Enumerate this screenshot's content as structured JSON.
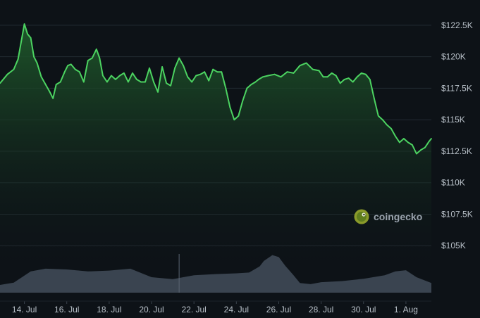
{
  "chart_data": {
    "type": "area",
    "title": "",
    "xlabel": "",
    "ylabel": "",
    "ylim": [
      102500,
      123500
    ],
    "y_ticks": [
      {
        "value": 122500,
        "label": "$122.5K"
      },
      {
        "value": 120000,
        "label": "$120K"
      },
      {
        "value": 117500,
        "label": "$117.5K"
      },
      {
        "value": 115000,
        "label": "$115K"
      },
      {
        "value": 112500,
        "label": "$112.5K"
      },
      {
        "value": 110000,
        "label": "$110K"
      },
      {
        "value": 107500,
        "label": "$107.5K"
      },
      {
        "value": 105000,
        "label": "$105K"
      }
    ],
    "x_ticks": [
      "14. Jul",
      "16. Jul",
      "18. Jul",
      "20. Jul",
      "22. Jul",
      "24. Jul",
      "26. Jul",
      "28. Jul",
      "30. Jul",
      "1. Aug"
    ],
    "x_tick_days": [
      0,
      2,
      4,
      6,
      8,
      10,
      12,
      14,
      16,
      18
    ],
    "xlim_days": [
      -1.15,
      19.2
    ],
    "series": [
      {
        "name": "",
        "x_days": [
          -1.15,
          -0.8,
          -0.5,
          -0.3,
          -0.15,
          0,
          0.15,
          0.3,
          0.45,
          0.6,
          0.8,
          1.0,
          1.2,
          1.35,
          1.5,
          1.7,
          1.9,
          2.05,
          2.2,
          2.4,
          2.6,
          2.8,
          3.0,
          3.2,
          3.4,
          3.55,
          3.7,
          3.9,
          4.1,
          4.3,
          4.5,
          4.7,
          4.9,
          5.1,
          5.3,
          5.5,
          5.7,
          5.9,
          6.1,
          6.3,
          6.5,
          6.7,
          6.9,
          7.1,
          7.3,
          7.5,
          7.7,
          7.9,
          8.1,
          8.3,
          8.5,
          8.7,
          8.9,
          9.1,
          9.3,
          9.5,
          9.7,
          9.9,
          10.1,
          10.3,
          10.5,
          10.7,
          10.9,
          11.05,
          11.25,
          11.5,
          11.8,
          12.1,
          12.4,
          12.7,
          13.0,
          13.3,
          13.6,
          13.9,
          14.1,
          14.3,
          14.5,
          14.7,
          14.9,
          15.1,
          15.3,
          15.5,
          15.7,
          15.9,
          16.1,
          16.3,
          16.5,
          16.7,
          16.9,
          17.1,
          17.3,
          17.5,
          17.7,
          17.9,
          18.1,
          18.3,
          18.5,
          18.7,
          18.9,
          19.1,
          19.2
        ],
        "values": [
          117900,
          118600,
          119000,
          119800,
          121200,
          122600,
          121800,
          121500,
          120000,
          119500,
          118400,
          117800,
          117200,
          116700,
          117800,
          118000,
          118800,
          119300,
          119400,
          119000,
          118800,
          118000,
          119700,
          119900,
          120600,
          119900,
          118500,
          118000,
          118500,
          118200,
          118500,
          118700,
          118000,
          118700,
          118200,
          118000,
          118000,
          119100,
          118000,
          117200,
          119200,
          117900,
          117700,
          119100,
          119900,
          119300,
          118400,
          118000,
          118500,
          118600,
          118800,
          118100,
          119000,
          118800,
          118800,
          117500,
          116000,
          115000,
          115300,
          116500,
          117500,
          117800,
          118000,
          118200,
          118400,
          118500,
          118600,
          118400,
          118800,
          118700,
          119300,
          119500,
          119000,
          118900,
          118400,
          118400,
          118700,
          118500,
          117900,
          118200,
          118300,
          118000,
          118400,
          118700,
          118600,
          118200,
          116700,
          115300,
          115000,
          114600,
          114300,
          113700,
          113200,
          113500,
          113200,
          113000,
          112300,
          112600,
          112800,
          113300,
          113500
        ]
      }
    ],
    "volume_x_days": [
      -1.15,
      -0.5,
      0.3,
      1.0,
      2.0,
      3.0,
      4.0,
      5.0,
      6.0,
      7.0,
      8.0,
      9.0,
      10.0,
      10.6,
      11.1,
      11.3,
      11.7,
      12.0,
      12.3,
      12.7,
      13.0,
      13.5,
      14.0,
      15.0,
      16.0,
      17.0,
      17.5,
      18.0,
      18.5,
      19.2
    ],
    "volume_values": [
      0.2,
      0.26,
      0.55,
      0.62,
      0.6,
      0.55,
      0.57,
      0.62,
      0.4,
      0.35,
      0.45,
      0.48,
      0.5,
      0.52,
      0.68,
      0.82,
      0.97,
      0.92,
      0.7,
      0.45,
      0.25,
      0.22,
      0.27,
      0.3,
      0.36,
      0.45,
      0.55,
      0.58,
      0.4,
      0.25
    ],
    "volume_spike_day": 7.3,
    "grid": true,
    "legend": "none",
    "colors": {
      "line": "#4cd361",
      "area_top": "#1f5a2b",
      "volume": "#3a4450",
      "grid": "#232b33",
      "background": "#0d1217"
    }
  },
  "watermark": {
    "text": "coingecko",
    "logo_icon": "gecko-icon"
  }
}
